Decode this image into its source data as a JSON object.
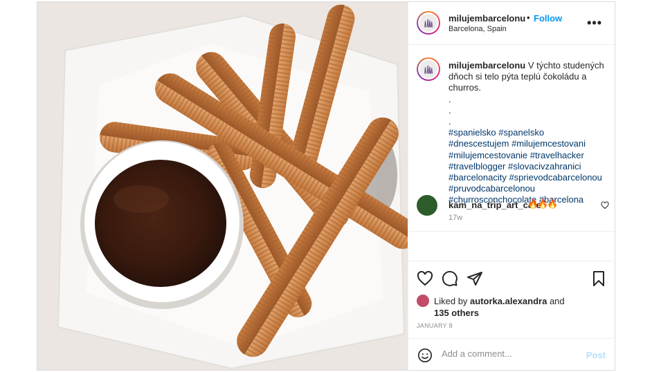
{
  "post": {
    "username": "milujembarcelonu",
    "separator": "•",
    "follow_label": "Follow",
    "location": "Barcelona, Spain",
    "more_label": "•••",
    "image_icon": "churros-with-chocolate-photo"
  },
  "caption": {
    "username": "milujembarcelonu",
    "text": "V týchto studených dňoch si telo pýta teplú čokoládu a churros.",
    "dots": [
      ".",
      ".",
      "."
    ],
    "hashtags": [
      "#spanielsko",
      "#spanelsko",
      "#dnescestujem",
      "#milujemcestovani",
      "#milujemcestovanie",
      "#travelhacker",
      "#travelblogger",
      "#slovacivzahranici",
      "#barcelonacity",
      "#sprievodcabarcelonou",
      "#pruvodcabarcelonou",
      "#churrosconchocolate",
      "#barcelona"
    ],
    "time": "17w"
  },
  "reply": {
    "username": "kam_na_trip_art_cafe",
    "emoji": "🔥🔥🔥"
  },
  "actions": {
    "like_icon": "heart-icon",
    "comment_icon": "comment-icon",
    "share_icon": "paper-plane-icon",
    "save_icon": "bookmark-icon"
  },
  "likes": {
    "prefix": "Liked by",
    "user": "autorka.alexandra",
    "conjunction": "and",
    "others": "135 others"
  },
  "date": "JANUARY 8",
  "add_comment": {
    "placeholder": "Add a comment...",
    "post_label": "Post"
  },
  "colors": {
    "accent": "#0095f6",
    "hashtag": "#00376b",
    "muted": "#8e8e8e",
    "post_disabled": "#b2dffc"
  }
}
